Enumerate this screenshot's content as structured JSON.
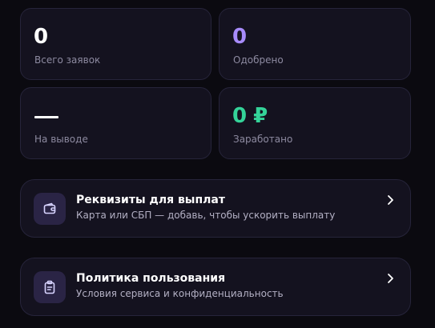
{
  "stats": [
    {
      "value": "0",
      "label": "Всего заявок",
      "color": "#ffffff"
    },
    {
      "value": "0",
      "label": "Одобрено",
      "color": "#a78bfa"
    },
    {
      "value": "—",
      "label": "На выводе",
      "color": "#ffffff"
    },
    {
      "value": "0 ₽",
      "label": "Заработано",
      "color": "#34d399"
    }
  ],
  "actions": [
    {
      "title": "Реквизиты для выплат",
      "subtitle": "Карта или СБП — добавь, чтобы ускорить выплату",
      "icon": "wallet-icon"
    },
    {
      "title": "Политика пользования",
      "subtitle": "Условия сервиса и конфиденциальность",
      "icon": "clipboard-icon"
    }
  ],
  "colors": {
    "background": "#0b0a10",
    "card": "#14121f",
    "card_border": "#26243a",
    "icon_bg": "#2a2445",
    "icon_stroke": "#d8d4ff",
    "muted_text": "#8d8aa0"
  }
}
